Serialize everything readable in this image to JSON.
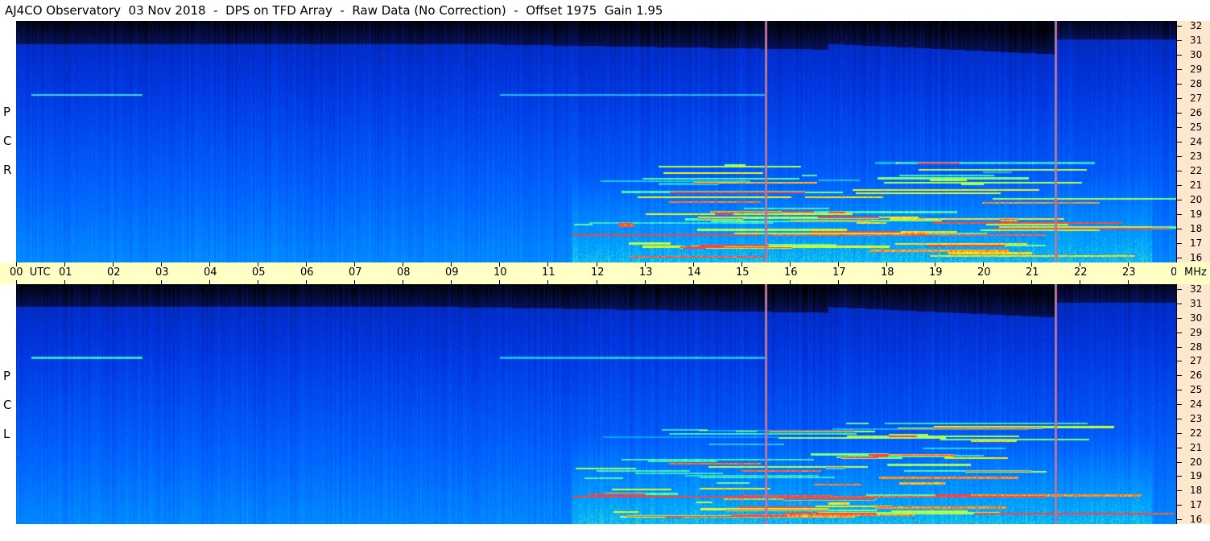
{
  "title": "AJ4CO Observatory  03 Nov 2018  -  DPS on TFD Array  -  Raw Data (No Correction)  -  Offset 1975  Gain 1.95",
  "chart_data": [
    {
      "type": "heatmap",
      "panel": "R C P",
      "polarization_letters": [
        "R",
        "C",
        "P"
      ],
      "x_axis": {
        "unit": "UTC",
        "tick_labels": [
          "00",
          "01",
          "02",
          "03",
          "04",
          "05",
          "06",
          "07",
          "08",
          "09",
          "10",
          "11",
          "12",
          "13",
          "14",
          "15",
          "16",
          "17",
          "18",
          "19",
          "20",
          "21",
          "22",
          "23",
          "00"
        ],
        "range": [
          0,
          24
        ]
      },
      "y_axis": {
        "unit": "MHz",
        "tick_labels": [
          "16",
          "17",
          "18",
          "19",
          "20",
          "21",
          "22",
          "23",
          "24",
          "25",
          "26",
          "27",
          "28",
          "29",
          "30",
          "31",
          "32"
        ],
        "range": [
          16,
          32
        ]
      },
      "markers_utc": [
        15.5,
        21.5
      ],
      "colormap": [
        "#000000",
        "#0a1a80",
        "#0033dd",
        "#0066ff",
        "#00aaff",
        "#55ffaa",
        "#ffff00",
        "#ff4040"
      ]
    },
    {
      "type": "heatmap",
      "panel": "L C P",
      "polarization_letters": [
        "L",
        "C",
        "P"
      ],
      "x_axis": {
        "unit": "UTC",
        "tick_labels": [
          "00",
          "01",
          "02",
          "03",
          "04",
          "05",
          "06",
          "07",
          "08",
          "09",
          "10",
          "11",
          "12",
          "13",
          "14",
          "15",
          "16",
          "17",
          "18",
          "19",
          "20",
          "21",
          "22",
          "23",
          "00"
        ],
        "range": [
          0,
          24
        ]
      },
      "y_axis": {
        "unit": "MHz",
        "tick_labels": [
          "16",
          "17",
          "18",
          "19",
          "20",
          "21",
          "22",
          "23",
          "24",
          "25",
          "26",
          "27",
          "28",
          "29",
          "30",
          "31",
          "32"
        ],
        "range": [
          16,
          32
        ]
      },
      "markers_utc": [
        15.5,
        21.5
      ],
      "colormap": [
        "#000000",
        "#0a1a80",
        "#0033dd",
        "#0066ff",
        "#00aaff",
        "#55ffaa",
        "#ffff00",
        "#ff4040"
      ]
    }
  ],
  "time_axis": {
    "first_label": "00",
    "utc_label": "UTC",
    "labels": [
      "01",
      "02",
      "03",
      "04",
      "05",
      "06",
      "07",
      "08",
      "09",
      "10",
      "11",
      "12",
      "13",
      "14",
      "15",
      "16",
      "17",
      "18",
      "19",
      "20",
      "21",
      "22",
      "23"
    ],
    "last_label": "00",
    "unit_label": "MHz"
  }
}
